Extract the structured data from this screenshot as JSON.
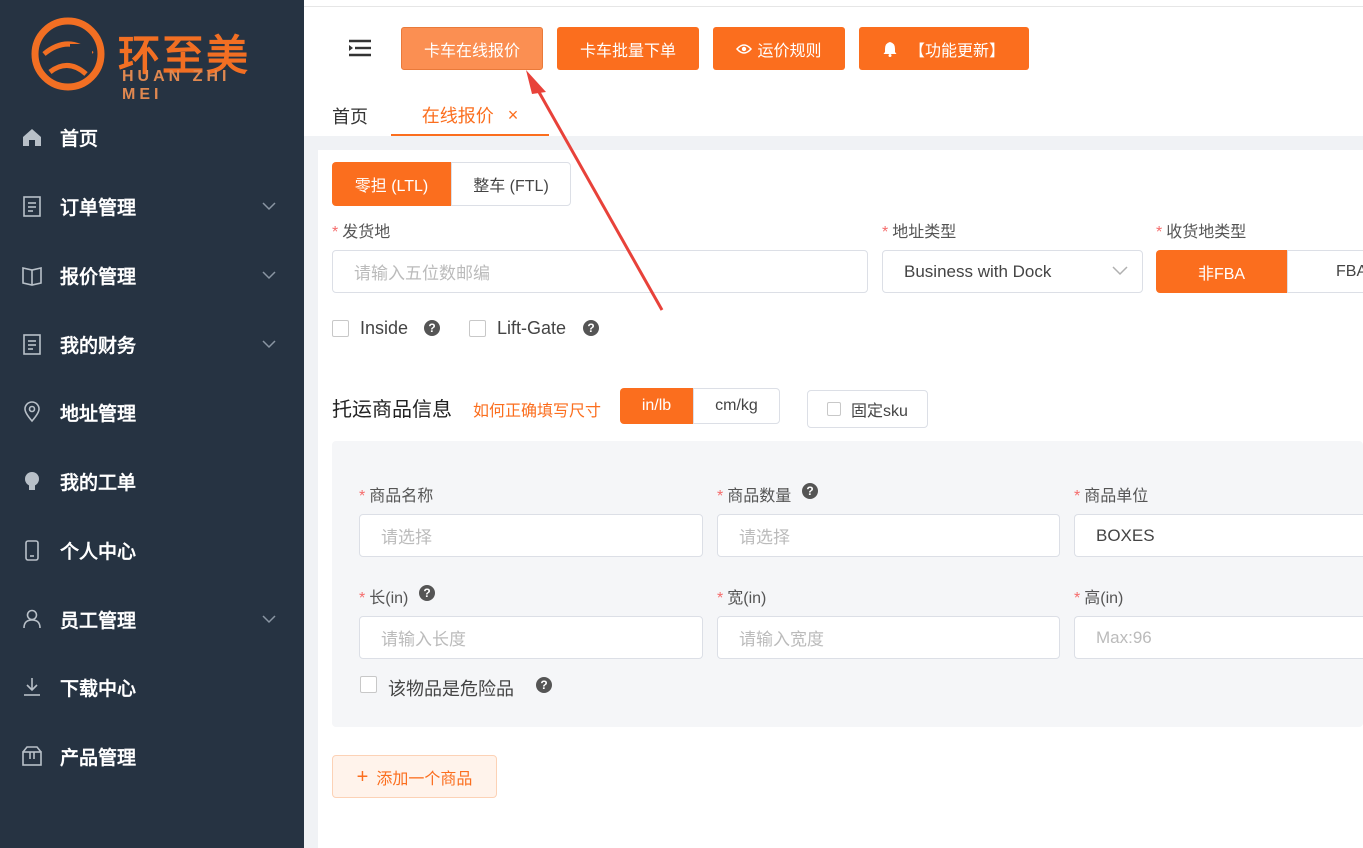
{
  "brand": {
    "name": "环至美",
    "sub": "HUAN ZHI MEI"
  },
  "sidebar": {
    "items": [
      {
        "label": "首页",
        "icon": "home-icon"
      },
      {
        "label": "订单管理",
        "icon": "document-icon"
      },
      {
        "label": "报价管理",
        "icon": "book-icon"
      },
      {
        "label": "我的财务",
        "icon": "document-icon"
      },
      {
        "label": "地址管理",
        "icon": "location-icon"
      },
      {
        "label": "我的工单",
        "icon": "bulb-icon"
      },
      {
        "label": "个人中心",
        "icon": "phone-icon"
      },
      {
        "label": "员工管理",
        "icon": "user-icon"
      },
      {
        "label": "下载中心",
        "icon": "download-icon"
      },
      {
        "label": "产品管理",
        "icon": "box-icon"
      }
    ]
  },
  "topbar": {
    "btn_online_quote": "卡车在线报价",
    "btn_batch_order": "卡车批量下单",
    "btn_pricing_rules": "运价规则",
    "btn_updates": "【功能更新】"
  },
  "tabs": {
    "home": "首页",
    "online_quote": "在线报价",
    "close": "×"
  },
  "mode": {
    "ltl": "零担 (LTL)",
    "ftl": "整车 (FTL)"
  },
  "origin": {
    "label": "发货地",
    "placeholder": "请输入五位数邮编"
  },
  "address_type": {
    "label": "地址类型",
    "value": "Business with Dock"
  },
  "dest_type": {
    "label": "收货地类型",
    "non_fba": "非FBA",
    "fba": "FBA"
  },
  "options": {
    "inside": "Inside",
    "liftgate": "Lift-Gate"
  },
  "goods": {
    "title": "托运商品信息",
    "howto": "如何正确填写尺寸",
    "unit_in": "in/lb",
    "unit_cm": "cm/kg",
    "fixed_sku": "固定sku",
    "name_label": "商品名称",
    "name_placeholder": "请选择",
    "qty_label": "商品数量",
    "qty_placeholder": "请选择",
    "unit_label": "商品单位",
    "unit_value": "BOXES",
    "len_label": "长(in)",
    "len_placeholder": "请输入长度",
    "wid_label": "宽(in)",
    "wid_placeholder": "请输入宽度",
    "hei_label": "高(in)",
    "hei_placeholder": "Max:96",
    "hazmat": "该物品是危险品",
    "add": "添加一个商品"
  },
  "colors": {
    "accent": "#fb6e1e",
    "sidebar": "#263342",
    "arrow": "#e8423a"
  }
}
